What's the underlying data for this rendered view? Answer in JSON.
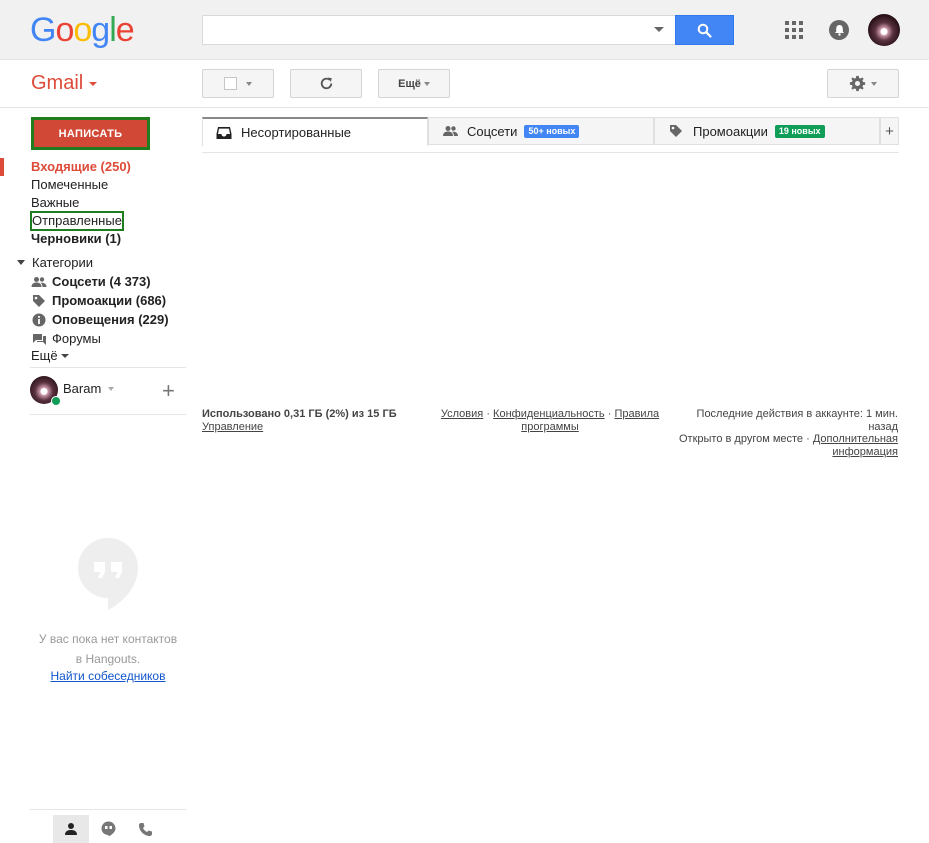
{
  "logo": {
    "letters": [
      "G",
      "o",
      "o",
      "g",
      "l",
      "e"
    ],
    "colors": [
      "#4285f4",
      "#ea4335",
      "#fbbc05",
      "#4285f4",
      "#34a853",
      "#ea4335"
    ]
  },
  "search": {
    "value": "",
    "placeholder": ""
  },
  "colors": {
    "accent": "#dd4b39",
    "search_button": "#4285f4",
    "social_badge": "#4285f4",
    "promo_badge": "#0f9d58",
    "compose_outline": "#1f7d1f",
    "online": "#0f9d58"
  },
  "header": {
    "gmail_label": "Gmail"
  },
  "toolbar": {
    "more_label": "Ещё"
  },
  "compose": {
    "label": "НАПИСАТЬ"
  },
  "nav": {
    "items": [
      {
        "label": "Входящие (250)",
        "state": "active"
      },
      {
        "label": "Помеченные"
      },
      {
        "label": "Важные"
      },
      {
        "label": "Отправленные",
        "state": "outlined"
      },
      {
        "label": "Черновики (1)",
        "state": "bold"
      }
    ],
    "categories_label": "Категории",
    "categories": [
      {
        "label": "Соцсети (4 373)",
        "icon": "people-icon",
        "bold": true
      },
      {
        "label": "Промоакции (686)",
        "icon": "tag-icon",
        "bold": true
      },
      {
        "label": "Оповещения (229)",
        "icon": "info-icon",
        "bold": true
      },
      {
        "label": "Форумы",
        "icon": "forum-icon",
        "bold": false
      }
    ],
    "more_label": "Ещё"
  },
  "user": {
    "name": "Baram",
    "status": "online"
  },
  "hangouts": {
    "empty_text_1": "У вас пока нет контактов",
    "empty_text_2": "в Hangouts.",
    "find_link": "Найти собеседников"
  },
  "tabs": [
    {
      "label": "Несортированные",
      "icon": "inbox-icon",
      "selected": true
    },
    {
      "label": "Соцсети",
      "icon": "people-icon",
      "badge": "50+ новых"
    },
    {
      "label": "Промоакции",
      "icon": "tag-icon",
      "badge": "19 новых"
    }
  ],
  "footer": {
    "storage": "Использовано 0,31 ГБ (2%) из 15 ГБ",
    "manage": "Управление",
    "terms": "Условия",
    "privacy": "Конфиденциальность",
    "program_1": "Правила",
    "program_2": "программы",
    "dot": "·",
    "activity_1": "Последние действия в аккаунте: 1 мин.",
    "activity_2": "назад",
    "opened_elsewhere": "Открыто в другом месте",
    "details_1": "Дополнительная",
    "details_2": "информация"
  }
}
